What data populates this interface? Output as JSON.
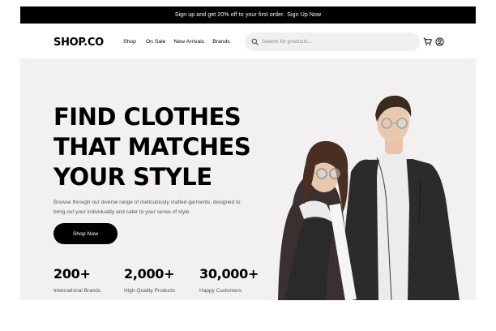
{
  "promo": {
    "text": "Sign up and get 20% off to your first order.",
    "link": "Sign Up Now"
  },
  "header": {
    "logo": "SHOP.CO",
    "nav": [
      "Shop",
      "On Sale",
      "New Arrivals",
      "Brands"
    ],
    "search_placeholder": "Search for products..."
  },
  "hero": {
    "headline": [
      "FIND CLOTHES",
      "THAT MATCHES",
      "YOUR STYLE"
    ],
    "description": "Browse through our diverse range of meticulously crafted garments, designed to bring out your individuality and cater to your sense of style.",
    "cta": "Shop Now",
    "stats": [
      {
        "value": "200+",
        "label": "International Brands"
      },
      {
        "value": "2,000+",
        "label": "High-Quality Products"
      },
      {
        "value": "30,000+",
        "label": "Happy Customers"
      }
    ]
  },
  "colors": {
    "promo_bg": "#000000",
    "hero_bg": "#f2f0f1",
    "button_bg": "#000000",
    "search_bg": "#f0f0f0"
  },
  "icons": [
    "search-icon",
    "cart-icon",
    "account-icon"
  ]
}
